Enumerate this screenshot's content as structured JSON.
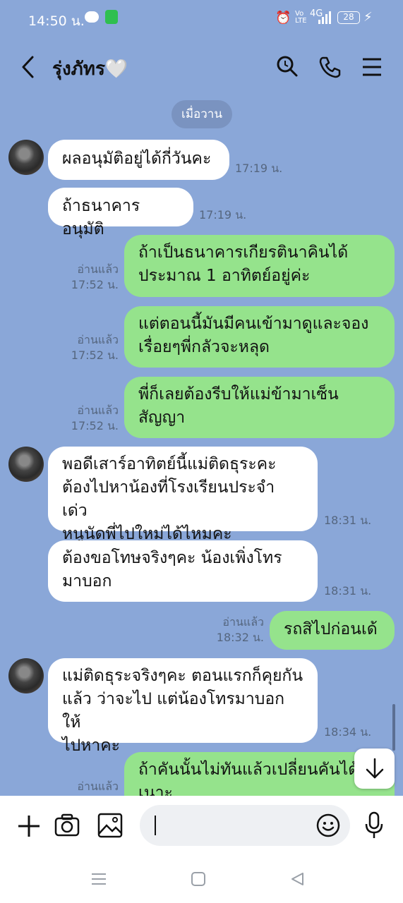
{
  "status": {
    "time": "14:50 น.",
    "battery": "28",
    "network": "4G"
  },
  "header": {
    "title": "รุ่งภัทร🤍"
  },
  "date_separator": "เมื่อวาน",
  "messages": [
    {
      "side": "in",
      "text": "ผลอนุมัติอยู่ได้กี่วันคะ",
      "time": "17:19 น."
    },
    {
      "side": "in",
      "text": "ถ้าธนาคารอนุมัติ",
      "time": "17:19 น."
    },
    {
      "side": "out",
      "text": "ถ้าเป็นธนาคารเกียรตินาคินได้\nประมาณ 1 อาทิตย์อยู่ค่ะ",
      "read": "อ่านแล้ว",
      "time": "17:52 น."
    },
    {
      "side": "out",
      "text": "แต่ตอนนี้มันมีคนเข้ามาดูและจอง\nเรื่อยๆพี่กลัวจะหลุด",
      "read": "อ่านแล้ว",
      "time": "17:52 น."
    },
    {
      "side": "out",
      "text": "พี่ก็เลยต้องรีบให้แม่ข้ามาเซ็น\nสัญญา",
      "read": "อ่านแล้ว",
      "time": "17:52 น."
    },
    {
      "side": "in",
      "text": "พอดีเสาร์อาทิตย์นี้แม่ติดธุระคะ\nต้องไปหาน้องที่โรงเรียนประจำ เด่ว\nหนูนัดพี่ไปใหม่ได้ไหมคะ",
      "time": "18:31 น."
    },
    {
      "side": "in",
      "text": "ต้องขอโทษจริงๆคะ น้องเพิ่งโทร\nมาบอก",
      "time": "18:31 น."
    },
    {
      "side": "out",
      "text": "รถสิไปก่อนเด้",
      "read": "อ่านแล้ว",
      "time": "18:32 น."
    },
    {
      "side": "in",
      "text": "แม่ติดธุระจริงๆคะ ตอนแรกก็คุยกัน\nแล้ว ว่าจะไป แต่น้องโทรมาบอก ให้\nไปหาคะ",
      "time": "18:34 น."
    },
    {
      "side": "out",
      "text": "ถ้าคันนั้นไม่ทันแล้วเปลี่ยนคันได้\nเนาะ",
      "read": "อ่านแล้ว",
      "time": ""
    }
  ],
  "colors": {
    "background": "#8aa7d8",
    "incoming_bubble": "#ffffff",
    "outgoing_bubble": "#95e38c"
  },
  "icons": [
    "back-icon",
    "search-icon",
    "phone-icon",
    "menu-icon",
    "plus-icon",
    "camera-icon",
    "image-icon",
    "emoji-icon",
    "mic-icon",
    "arrow-down-icon"
  ]
}
